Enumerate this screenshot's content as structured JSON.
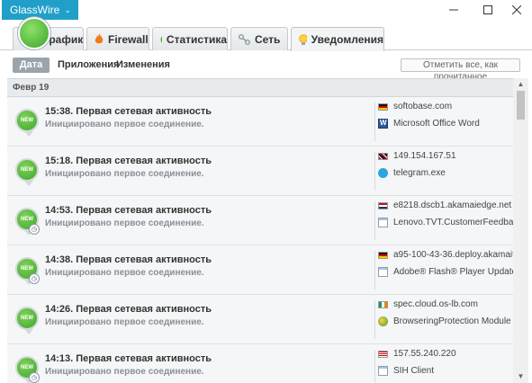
{
  "app": {
    "name": "GlassWire"
  },
  "tabs": [
    {
      "label": "График",
      "icon": "graph-logo-icon"
    },
    {
      "label": "Firewall",
      "icon": "flame-icon"
    },
    {
      "label": "Статистика",
      "icon": "stats-icon"
    },
    {
      "label": "Сеть",
      "icon": "network-icon"
    },
    {
      "label": "Уведомления",
      "icon": "bulb-icon",
      "active": true
    }
  ],
  "subnav": {
    "date": "Дата",
    "apps": "Приложения",
    "changes": "Изменения",
    "mark_all_read": "Отметить все, как прочитанное"
  },
  "date_header": "Февр 19",
  "badge_label": "NEW",
  "events": [
    {
      "title": "15:38. Первая сетевая активность",
      "subtitle": "Инициировано первое соединение.",
      "host": "softobase.com",
      "flag": "de",
      "app": "Microsoft Office Word",
      "app_icon": "word-icon",
      "clock": false
    },
    {
      "title": "15:18. Первая сетевая активность",
      "subtitle": "Инициировано первое соединение.",
      "host": "149.154.167.51",
      "flag": "gb",
      "app": "telegram.exe",
      "app_icon": "telegram-icon",
      "clock": false
    },
    {
      "title": "14:53. Первая сетевая активность",
      "subtitle": "Инициировано первое соединение.",
      "host": "e8218.dscb1.akamaiedge.net",
      "flag": "nl",
      "app": "Lenovo.TVT.CustomerFeedback...",
      "app_icon": "window-icon",
      "clock": true
    },
    {
      "title": "14:38. Первая сетевая активность",
      "subtitle": "Инициировано первое соединение.",
      "host": "a95-100-43-36.deploy.akamaite...",
      "flag": "de",
      "app": "Adobe® Flash® Player Update ...",
      "app_icon": "window-icon",
      "clock": true
    },
    {
      "title": "14:26. Первая сетевая активность",
      "subtitle": "Инициировано первое соединение.",
      "host": "spec.cloud.os-lb.com",
      "flag": "ie",
      "app": "BrowseringProtection Module",
      "app_icon": "shield-icon",
      "clock": false
    },
    {
      "title": "14:13. Первая сетевая активность",
      "subtitle": "Инициировано первое соединение.",
      "host": "157.55.240.220",
      "flag": "us",
      "app": "SIH Client",
      "app_icon": "window-icon",
      "clock": true
    }
  ],
  "colors": {
    "accent": "#20a0c8",
    "badge_green": "#3ea52b"
  }
}
